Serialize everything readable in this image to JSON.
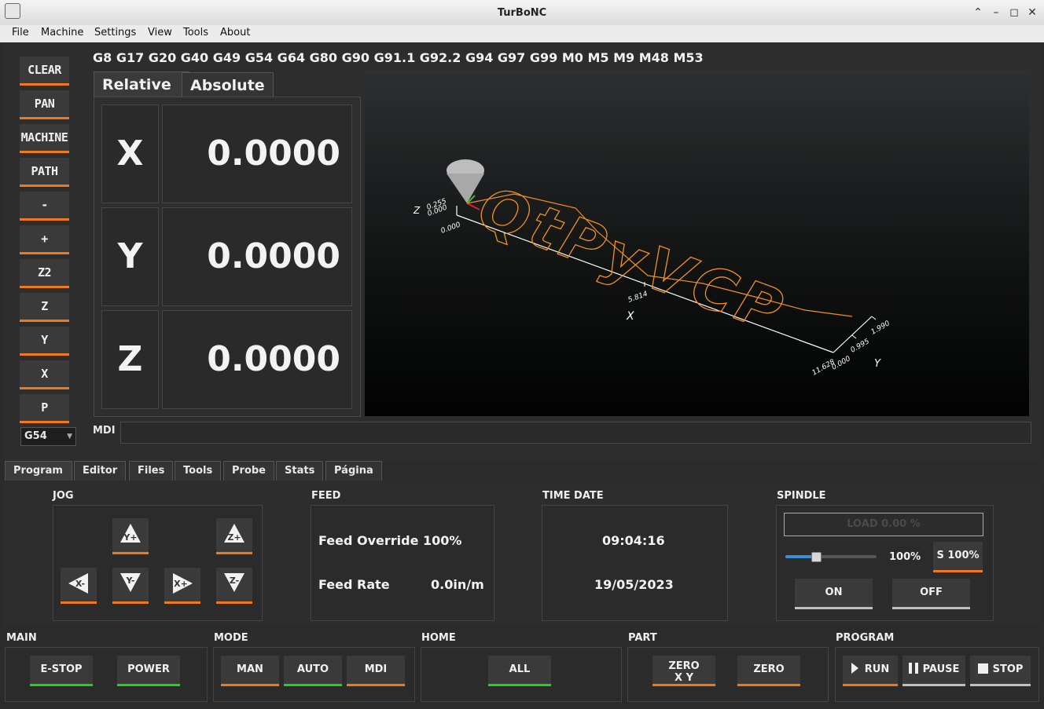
{
  "window": {
    "title": "TurBoNC"
  },
  "menu": [
    "File",
    "Machine",
    "Settings",
    "View",
    "Tools",
    "About"
  ],
  "sidebar": [
    "CLEAR",
    "PAN",
    "MACHINE",
    "PATH",
    "-",
    "+",
    "Z2",
    "Z",
    "Y",
    "X",
    "P"
  ],
  "wcs_select": "G54",
  "gcodes": "G8 G17 G20 G40 G49 G54 G64 G80 G90 G91.1 G92.2 G94 G97 G99  M0 M5 M9 M48 M53",
  "dro": {
    "tabs": [
      "Relative",
      "Absolute"
    ],
    "active_tab": "Relative",
    "axes": [
      {
        "axis": "X",
        "value": "0.0000"
      },
      {
        "axis": "Y",
        "value": "0.0000"
      },
      {
        "axis": "Z",
        "value": "0.0000"
      }
    ]
  },
  "viewer": {
    "toolpath_text": "QtPyVCP",
    "labels": {
      "x_axis": "X",
      "y_axis": "Y",
      "z_axis": "Z",
      "x_mid": "5.814",
      "x_end": "11.628",
      "x_start": "0.000",
      "y_start": "0.000",
      "y_mid": "0.995",
      "y_end": "1.990",
      "z_a": "0.255",
      "z_b": "0.000"
    },
    "colors": {
      "toolpath": "#f0901e",
      "extents": "#ffffff",
      "tool": "#bdbdbd"
    }
  },
  "mdi": {
    "label": "MDI",
    "value": ""
  },
  "bottom_tabs": [
    "Program",
    "Editor",
    "Files",
    "Tools",
    "Probe",
    "Stats",
    "Página"
  ],
  "active_bottom_tab": "Program",
  "sections": {
    "jog": "JOG",
    "feed": "FEED",
    "time_date": "TIME DATE",
    "spindle": "SPINDLE",
    "main": "MAIN",
    "mode": "MODE",
    "home": "HOME",
    "part": "PART",
    "program": "PROGRAM"
  },
  "jog_buttons": [
    "Y+",
    "Z+",
    "X-",
    "Y-",
    "X+",
    "Z-"
  ],
  "feed": {
    "override_label": "Feed Override 100%",
    "rate_label": "Feed Rate",
    "rate_value": "0.0in/m"
  },
  "time": "09:04:16",
  "date": "19/05/2023",
  "spindle": {
    "load_text": "LOAD 0.00 %",
    "slider_percent": "100%",
    "slider_level": 0.33,
    "speed_button": "S 100%",
    "on": "ON",
    "off": "OFF"
  },
  "main_buttons": [
    "E-STOP",
    "POWER"
  ],
  "mode_buttons": [
    "MAN",
    "AUTO",
    "MDI"
  ],
  "home_buttons": [
    "ALL"
  ],
  "part_buttons": [
    "ZERO\nX Y",
    "ZERO"
  ],
  "program_buttons": [
    "RUN",
    "PAUSE",
    "STOP"
  ],
  "indicator_colors": {
    "active": "#1ed21e",
    "accent": "#f07a1a",
    "neutral": "#bfbfbf"
  }
}
